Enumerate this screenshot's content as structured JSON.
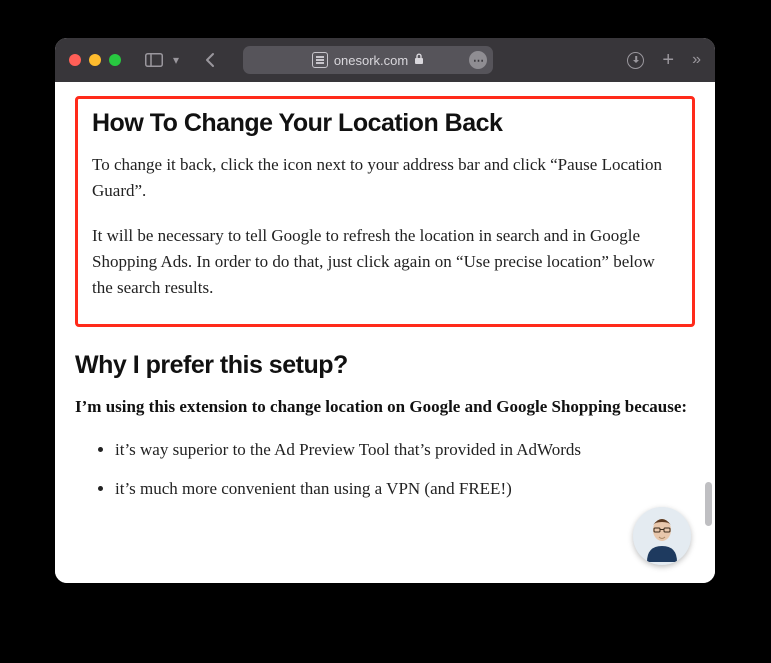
{
  "browser": {
    "domain": "onesork.com"
  },
  "article": {
    "section1": {
      "title": "How To Change Your Location Back",
      "p1": "To change it back, click the icon next to your address bar and click “Pause Location Guard”.",
      "p2": "It will be necessary to tell Google to refresh the location in search and in Google Shopping Ads. In order to do that, just click again on “Use precise location” below the search results."
    },
    "section2": {
      "title": "Why I prefer this setup?",
      "intro": "I’m using this extension to change location on Google and Google Shopping because:",
      "bullets": [
        "it’s way superior to the Ad Preview Tool that’s provided in AdWords",
        "it’s much more convenient than using a VPN (and FREE!)"
      ]
    }
  }
}
